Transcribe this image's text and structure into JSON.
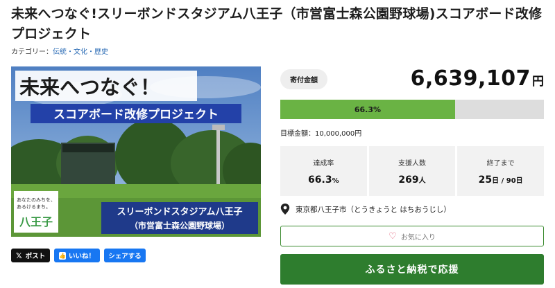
{
  "title": "未来へつなぐ!スリーボンドスタジアム八王子（市営富士森公園野球場)スコアボード改修プロジェクト",
  "category": {
    "label": "カテゴリー：",
    "link": "伝統・文化・歴史"
  },
  "hero": {
    "headline": "未来へつなぐ！",
    "subheadline": "スコアボード改修プロジェクト",
    "stadium_name_line1": "スリーボンドスタジアム八王子",
    "stadium_name_line2": "（市営富士森公園野球場）",
    "logo_line1": "あなたのみちを、",
    "logo_line2": "あるけるまち。",
    "logo_city": "八王子"
  },
  "share": {
    "x_label": "ポスト",
    "fb_label": "いいね！",
    "share_label": "シェアする"
  },
  "funding": {
    "amount_label": "寄付金額",
    "amount": "6,639,107",
    "amount_unit": "円",
    "progress_text": "66.3%",
    "progress_fraction": 0.663,
    "goal_text": "目標金額：10,000,000円"
  },
  "stats": {
    "rate_label": "達成率",
    "rate_value": "66.3",
    "rate_unit": "%",
    "supporters_label": "支援人数",
    "supporters_value": "269",
    "supporters_unit": "人",
    "remaining_label": "終了まで",
    "remaining_value": "25",
    "remaining_unit": "日 / 90日"
  },
  "location": "東京都八王子市（とうきょうと はちおうじし）",
  "favorite_label": "お気に入り",
  "donate_label": "ふるさと納税で応援",
  "colors": {
    "progress": "#6ab344",
    "donate": "#2e7d2e",
    "link": "#2a6bb5",
    "heading_bg": "#1f3a8a"
  }
}
